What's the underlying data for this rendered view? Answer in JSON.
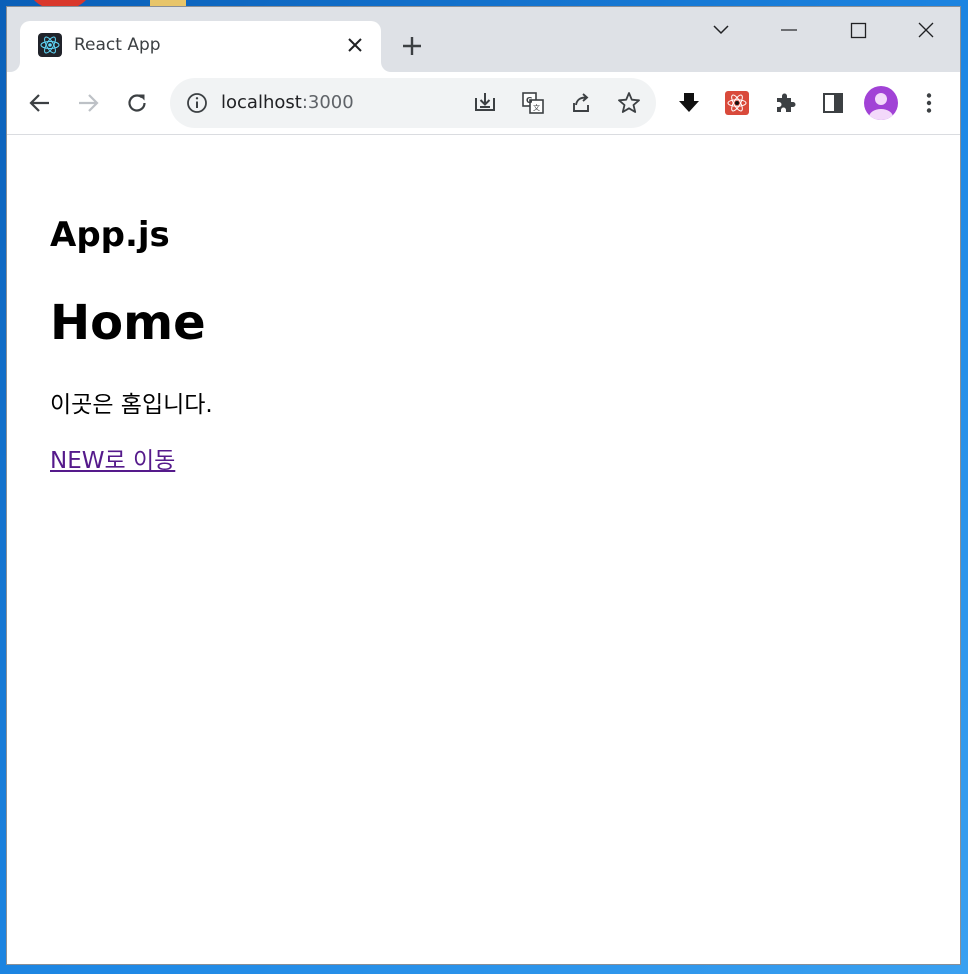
{
  "browser": {
    "tab": {
      "title": "React App",
      "favicon": "react-logo-icon"
    },
    "address": {
      "host": "localhost",
      "port": ":3000"
    },
    "colors": {
      "tabstrip": "#dee1e6",
      "omnibox": "#f1f3f4",
      "avatar": "#a142d6",
      "favicon_bg": "#20232a",
      "react_blue": "#61dafb"
    }
  },
  "page": {
    "heading_small": "App.js",
    "heading_large": "Home",
    "paragraph": "이곳은 홈입니다.",
    "link_text": "NEW로 이동",
    "link_color": "#551a8b"
  }
}
